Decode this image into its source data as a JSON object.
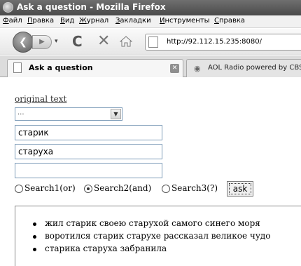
{
  "window": {
    "title": "Ask a question - Mozilla Firefox"
  },
  "menu": [
    "Файл",
    "Правка",
    "Вид",
    "Журнал",
    "Закладки",
    "Инструменты",
    "Справка"
  ],
  "address_bar": {
    "url": "http://92.112.15.235:8080/"
  },
  "tabs": [
    {
      "label": "Ask a question",
      "active": true
    },
    {
      "label": "AOL Radio powered by CBS",
      "active": false
    }
  ],
  "page": {
    "link_text": "original text",
    "select_value": "...",
    "inputs": [
      "старик",
      "старуха",
      ""
    ],
    "radios": [
      {
        "label": "Search1(or)",
        "checked": false
      },
      {
        "label": "Search2(and)",
        "checked": true
      },
      {
        "label": "Search3(?)",
        "checked": false
      }
    ],
    "ask_label": "ask",
    "results": [
      "жил старик своею старухой самого синего моря",
      "воротился старик старухе рассказал великое чудо",
      "старика старуха забранила"
    ]
  }
}
